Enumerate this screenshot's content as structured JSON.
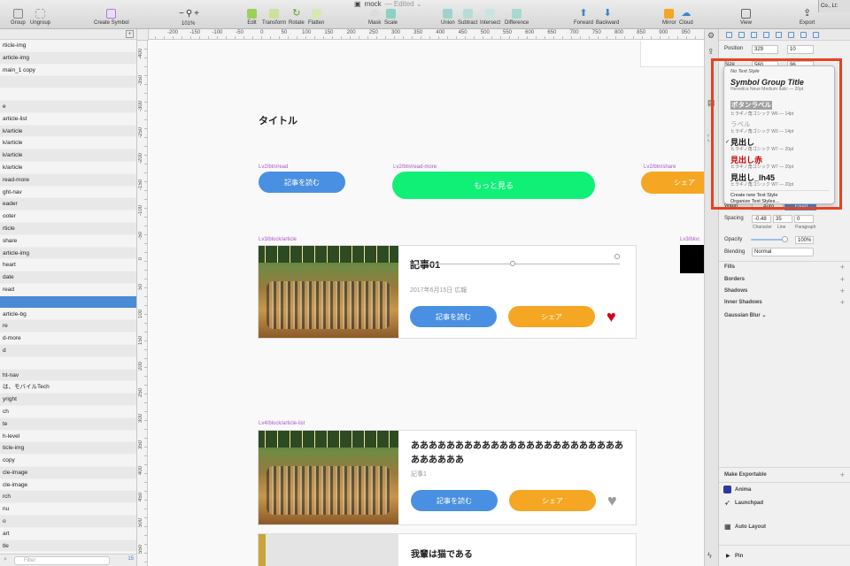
{
  "window": {
    "title": "mock",
    "edited": "— Edited ⌄"
  },
  "toolbar": {
    "group": "Group",
    "ungroup": "Ungroup",
    "create_symbol": "Create Symbol",
    "zoom_minus": "−",
    "zoom_plus": "+",
    "zoom": "101%",
    "edit": "Edit",
    "transform": "Transform",
    "rotate": "Rotate",
    "flatten": "Flatten",
    "mask": "Mask",
    "scale": "Scale",
    "union": "Union",
    "subtract": "Subtract",
    "intersect": "Intersect",
    "difference": "Difference",
    "forward": "Forward",
    "backward": "Backward",
    "mirror": "Mirror",
    "cloud": "Cloud",
    "view": "View",
    "export": "Export"
  },
  "bg_window": {
    "tab": "Co., Lt:",
    "header": "ctor icons -"
  },
  "layers": {
    "items": [
      "rticle-img",
      "article-img",
      "main_1 copy",
      "",
      "",
      "e",
      "article-list",
      "k/article",
      "k/article",
      "k/article",
      "k/article",
      "read-more",
      "ght-nav",
      "eader",
      "ooter",
      "rticle",
      "share",
      "article-img",
      "heart",
      "date",
      "read",
      "",
      "article-bg",
      "re",
      "d-more",
      "d",
      "",
      "ht-nav",
      "は、モバイルTech",
      "yright",
      "ch",
      "te",
      "h-level",
      "ticle-img",
      " copy",
      "cle-image",
      "cle-image",
      "rch",
      "nu",
      "o",
      "art",
      "tle"
    ],
    "filter_placeholder": "Filter",
    "count": "15"
  },
  "ruler": {
    "h": [
      "-200",
      "-150",
      "-100",
      "-50",
      "0",
      "50",
      "100",
      "150",
      "200",
      "250",
      "300",
      "350",
      "400",
      "450",
      "500",
      "550",
      "600",
      "650",
      "700",
      "750",
      "800",
      "850",
      "900",
      "950"
    ],
    "v": [
      "-400",
      "-350",
      "-300",
      "-250",
      "-200",
      "-150",
      "-100",
      "-50",
      "0",
      "50",
      "100",
      "150",
      "200",
      "250",
      "300",
      "350",
      "400",
      "450",
      "500",
      "550"
    ]
  },
  "canvas": {
    "title": "タイトル",
    "labels": {
      "read": "Lv2/btn/read",
      "readmore": "Lv2/btn/read-more",
      "share": "Lv2/btn/share",
      "article": "Lv3/block/article",
      "block_r": "Lv3/bloc",
      "list": "Lv4/block/article-list"
    },
    "btn_read": "記事を読む",
    "btn_more": "もっと見る",
    "btn_share": "シェア",
    "article": {
      "title": "記事01",
      "date": "2017年6月15日 広報",
      "read": "記事を読む",
      "share": "シェア",
      "heart": "♥"
    },
    "list_item": {
      "title": "ああああああああああああああああああああああああああああああ",
      "sub": "記事1",
      "read": "記事を読む",
      "share": "シェア",
      "heart": "♥"
    },
    "list_item2": {
      "title": "我輩は猫である"
    }
  },
  "inspector": {
    "position_label": "Position",
    "x": "329",
    "y": "10",
    "size_label": "Size",
    "w": "560",
    "h": "96",
    "width_label": "Width",
    "width_auto": "Auto",
    "width_fixed": "Fixed",
    "spacing_label": "Spacing",
    "character": "-0.48",
    "line": "35",
    "paragraph": "0",
    "character_label": "Character",
    "line_label": "Line",
    "paragraph_label": "Paragraph",
    "opacity_label": "Opacity",
    "opacity": "100%",
    "blending_label": "Blending",
    "blending": "Normal",
    "fills": "Fills",
    "borders": "Borders",
    "shadows": "Shadows",
    "inner_shadows": "Inner Shadows",
    "gaussian": "Gaussian Blur ⌄",
    "make_exportable": "Make Exportable",
    "anima": "Anima",
    "launchpad": "Launchpad",
    "auto_layout": "Auto Layout",
    "pin": "Pin"
  },
  "text_styles": {
    "none": "No Text Style",
    "items": [
      {
        "name": "Symbol Group Title",
        "spec": "Helvetica Neue Medium Italic — 20pt",
        "color": "#222222",
        "style": "italic"
      },
      {
        "name": "ボタンラベル",
        "spec": "ヒラギノ角ゴシック W6 — 14pt",
        "color": "#ffffff",
        "style": "btn"
      },
      {
        "name": "ラベル",
        "spec": "ヒラギノ角ゴシック W3 — 14pt",
        "color": "#999999",
        "style": "light"
      },
      {
        "name": "見出し",
        "spec": "ヒラギノ角ゴシック W7 — 20pt",
        "color": "#111111",
        "style": "check"
      },
      {
        "name": "見出し赤",
        "spec": "ヒラギノ角ゴシック W7 — 20pt",
        "color": "#cc0000",
        "style": "bold"
      },
      {
        "name": "見出し_lh45",
        "spec": "ヒラギノ角ゴシック W7 — 20pt",
        "color": "#111111",
        "style": "bold"
      }
    ],
    "create": "Create new Text Style",
    "organize": "Organize Text Styles…",
    "check": "✓"
  },
  "colors": {
    "blue": "#4a90e2",
    "green": "#10f077",
    "orange": "#f5a623",
    "heart_red": "#d0021b",
    "heart_gray": "#9b9b9b",
    "highlight": "#e8421e"
  }
}
